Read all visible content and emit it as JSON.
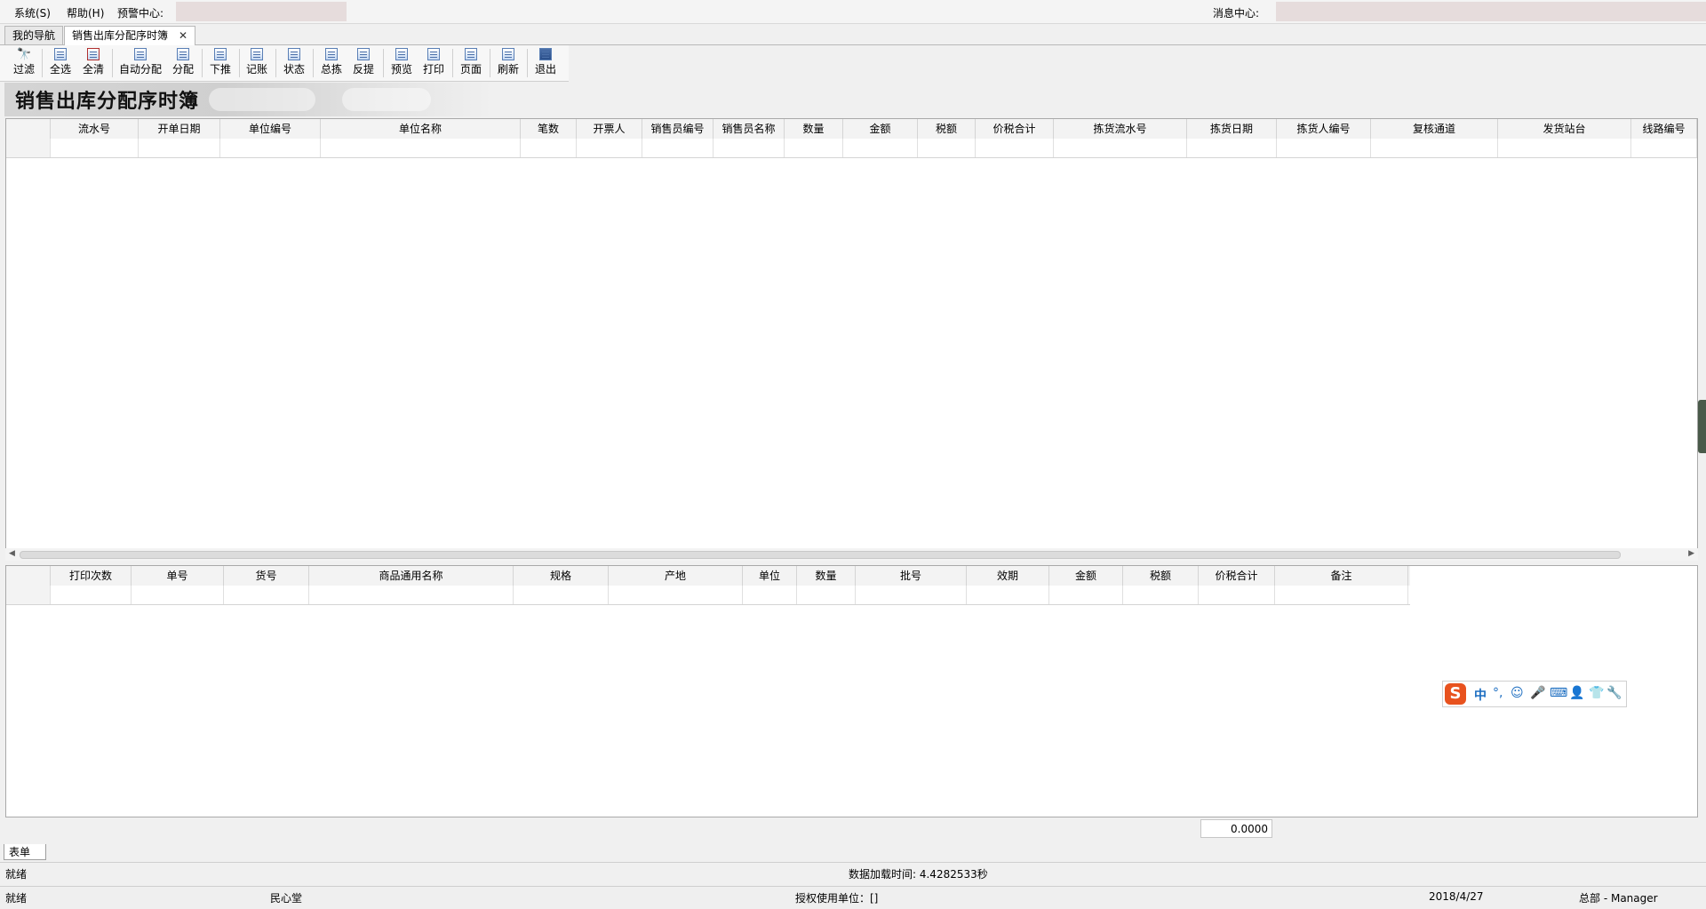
{
  "menu": {
    "items": [
      "系统(S)",
      "帮助(H)",
      "预警中心:"
    ],
    "message_center": "消息中心:"
  },
  "tabs": [
    {
      "label": "我的导航",
      "active": false
    },
    {
      "label": "销售出库分配序时簿",
      "active": true,
      "close": "✕"
    }
  ],
  "toolbar": [
    {
      "label": "过滤",
      "icon": "binoculars-icon"
    },
    {
      "label": "全选",
      "icon": "select-all-icon"
    },
    {
      "label": "全清",
      "icon": "clear-all-icon"
    },
    {
      "label": "自动分配",
      "icon": "auto-assign-icon"
    },
    {
      "label": "分配",
      "icon": "assign-icon"
    },
    {
      "label": "下推",
      "icon": "push-down-icon"
    },
    {
      "label": "记账",
      "icon": "post-icon"
    },
    {
      "label": "状态",
      "icon": "status-icon"
    },
    {
      "label": "总拣",
      "icon": "total-pick-icon"
    },
    {
      "label": "反提",
      "icon": "reverse-icon"
    },
    {
      "label": "预览",
      "icon": "preview-icon"
    },
    {
      "label": "打印",
      "icon": "print-icon"
    },
    {
      "label": "页面",
      "icon": "page-setup-icon"
    },
    {
      "label": "刷新",
      "icon": "refresh-icon"
    },
    {
      "label": "退出",
      "icon": "exit-icon"
    }
  ],
  "banner_title": "销售出库分配序时簿",
  "master_grid": {
    "columns": [
      "流水号",
      "开单日期",
      "单位编号",
      "单位名称",
      "笔数",
      "开票人",
      "销售员编号",
      "销售员名称",
      "数量",
      "金额",
      "税额",
      "价税合计",
      "拣货流水号",
      "拣货日期",
      "拣货人编号",
      "复核通道",
      "发货站台",
      "线路编号"
    ]
  },
  "detail_grid": {
    "columns": [
      "打印次数",
      "单号",
      "货号",
      "商品通用名称",
      "规格",
      "产地",
      "单位",
      "数量",
      "批号",
      "效期",
      "金额",
      "税额",
      "价税合计",
      "备注"
    ]
  },
  "total_value": "0.0000",
  "sheet_tab": "表单",
  "status": {
    "ready": "就绪",
    "load_time": "数据加载时间: 4.4282533秒",
    "ready2": "就绪",
    "company": "民心堂",
    "licensed": "授权使用单位：[]",
    "date": "2018/4/27",
    "user": "总部 - Manager"
  },
  "ime": {
    "logo": "S",
    "icons": [
      "中",
      "°,",
      "☺",
      "🎤",
      "⌨",
      "👤",
      "👕",
      "🔧"
    ]
  }
}
